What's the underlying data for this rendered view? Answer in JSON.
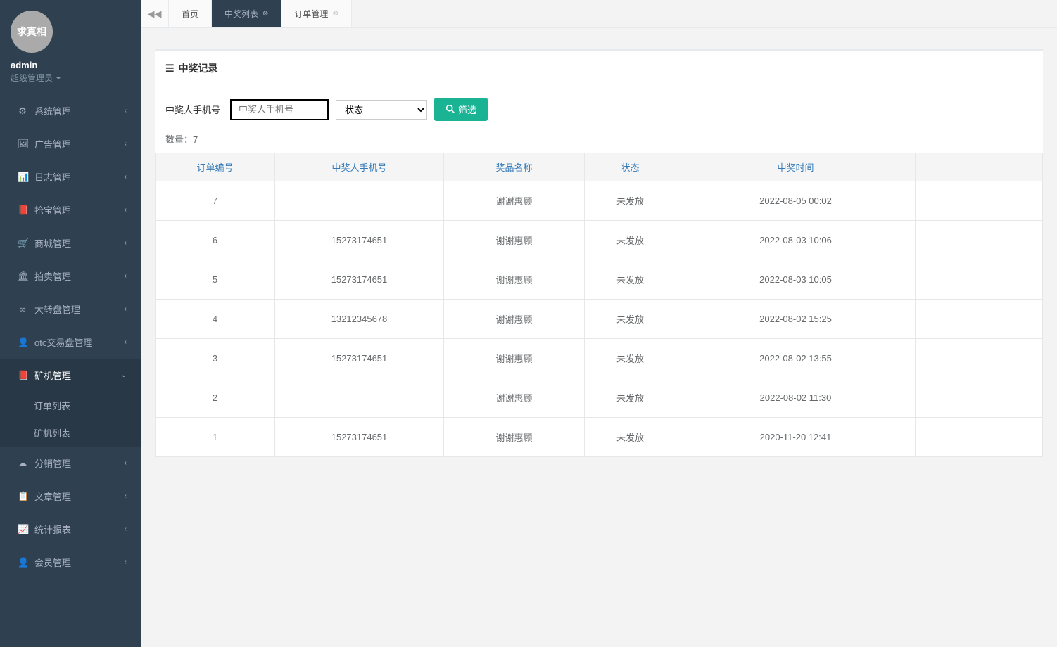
{
  "profile": {
    "avatar_text": "求真相",
    "username": "admin",
    "role": "超级管理员"
  },
  "sidebar": {
    "items": [
      {
        "label": "系统管理",
        "icon": "⚙"
      },
      {
        "label": "广告管理",
        "icon": "🖼"
      },
      {
        "label": "日志管理",
        "icon": "📊"
      },
      {
        "label": "抢宝管理",
        "icon": "📕"
      },
      {
        "label": "商城管理",
        "icon": "🛒"
      },
      {
        "label": "拍卖管理",
        "icon": "🏛"
      },
      {
        "label": "大转盘管理",
        "icon": "∞"
      },
      {
        "label": "otc交易盘管理",
        "icon": "👤"
      },
      {
        "label": "矿机管理",
        "icon": "📕",
        "active": true,
        "children": [
          {
            "label": "订单列表"
          },
          {
            "label": "矿机列表"
          }
        ]
      },
      {
        "label": "分销管理",
        "icon": "☁"
      },
      {
        "label": "文章管理",
        "icon": "📋"
      },
      {
        "label": "统计报表",
        "icon": "📈"
      },
      {
        "label": "会员管理",
        "icon": "👤"
      }
    ]
  },
  "tabs": [
    {
      "label": "首页",
      "closable": false
    },
    {
      "label": "中奖列表",
      "closable": true,
      "active": true
    },
    {
      "label": "订单管理",
      "closable": true
    }
  ],
  "panel": {
    "title": "中奖记录"
  },
  "filter": {
    "phone_label": "中奖人手机号",
    "phone_placeholder": "中奖人手机号",
    "status_option": "状态",
    "button": "筛选"
  },
  "count": {
    "label": "数量：",
    "value": "7"
  },
  "table": {
    "headers": [
      "订单编号",
      "中奖人手机号",
      "奖品名称",
      "状态",
      "中奖时间",
      ""
    ],
    "rows": [
      {
        "id": "7",
        "phone": "",
        "prize": "谢谢惠顾",
        "status": "未发放",
        "time": "2022-08-05 00:02"
      },
      {
        "id": "6",
        "phone": "15273174651",
        "prize": "谢谢惠顾",
        "status": "未发放",
        "time": "2022-08-03 10:06"
      },
      {
        "id": "5",
        "phone": "15273174651",
        "prize": "谢谢惠顾",
        "status": "未发放",
        "time": "2022-08-03 10:05"
      },
      {
        "id": "4",
        "phone": "13212345678",
        "prize": "谢谢惠顾",
        "status": "未发放",
        "time": "2022-08-02 15:25"
      },
      {
        "id": "3",
        "phone": "15273174651",
        "prize": "谢谢惠顾",
        "status": "未发放",
        "time": "2022-08-02 13:55"
      },
      {
        "id": "2",
        "phone": "",
        "prize": "谢谢惠顾",
        "status": "未发放",
        "time": "2022-08-02 11:30"
      },
      {
        "id": "1",
        "phone": "15273174651",
        "prize": "谢谢惠顾",
        "status": "未发放",
        "time": "2020-11-20 12:41"
      }
    ]
  }
}
